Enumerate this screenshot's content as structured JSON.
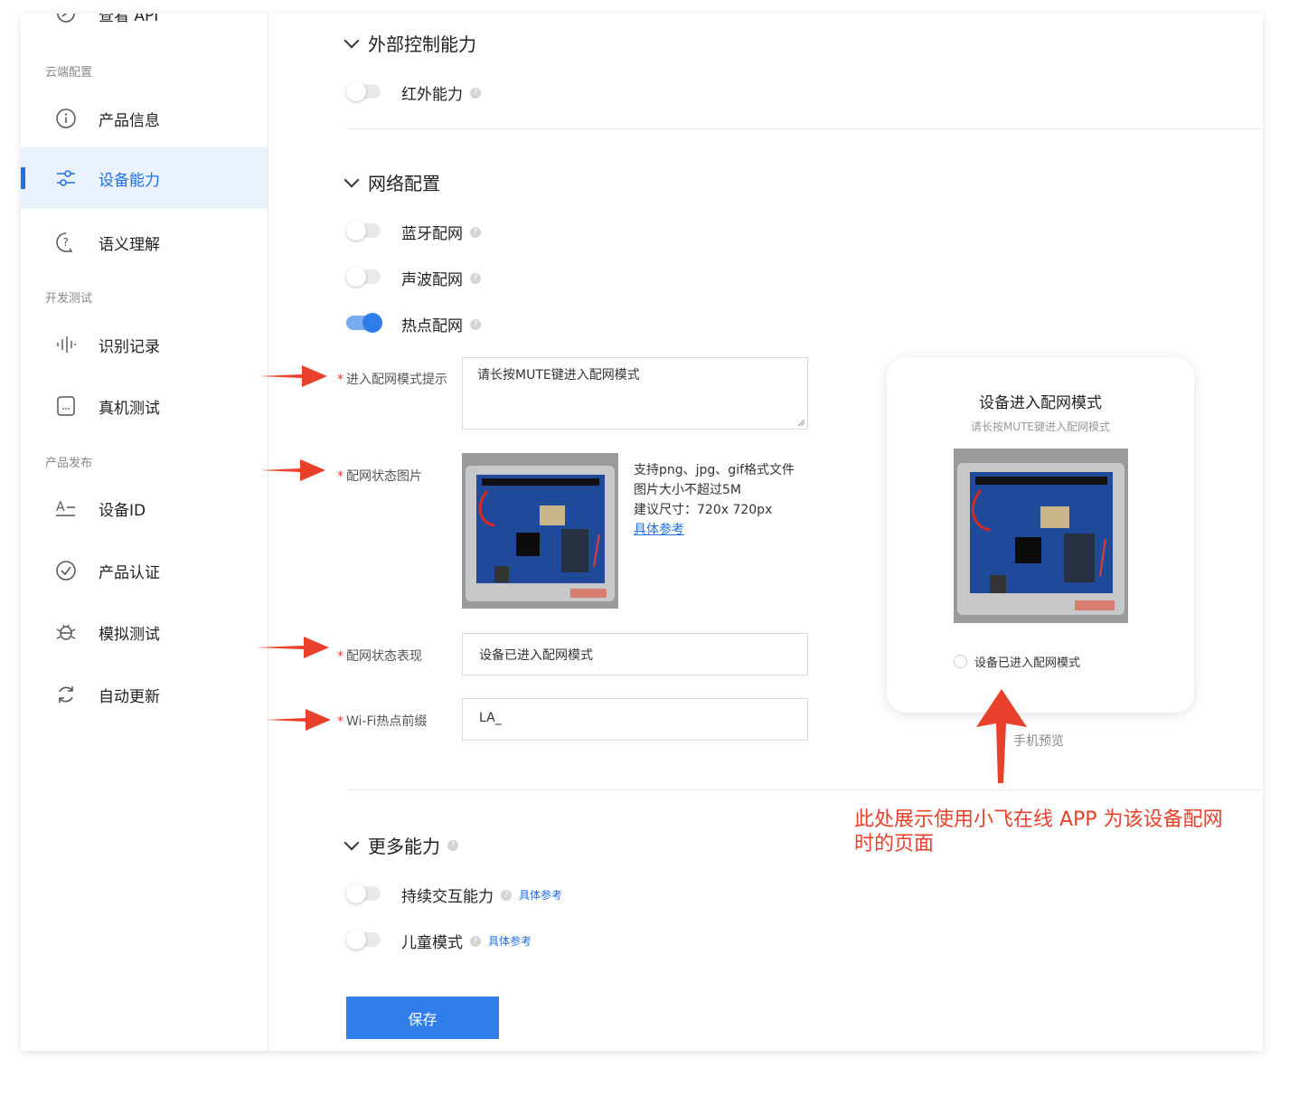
{
  "sidebar": {
    "top_cut_item": "查看 API",
    "sections": [
      {
        "label": "云端配置"
      },
      {
        "label": "开发测试"
      },
      {
        "label": "产品发布"
      }
    ],
    "items": [
      {
        "label": "产品信息",
        "icon": "info-icon"
      },
      {
        "label": "设备能力",
        "icon": "sliders-icon"
      },
      {
        "label": "语义理解",
        "icon": "question-bubble-icon"
      },
      {
        "label": "识别记录",
        "icon": "waveform-icon"
      },
      {
        "label": "真机测试",
        "icon": "device-chat-icon"
      },
      {
        "label": "设备ID",
        "icon": "id-text-icon"
      },
      {
        "label": "产品认证",
        "icon": "check-circle-icon"
      },
      {
        "label": "模拟测试",
        "icon": "bug-icon"
      },
      {
        "label": "自动更新",
        "icon": "refresh-icon"
      }
    ]
  },
  "main": {
    "external_control": {
      "title": "外部控制能力",
      "toggles": [
        {
          "label": "红外能力",
          "on": false
        }
      ]
    },
    "network_config": {
      "title": "网络配置",
      "toggles": [
        {
          "label": "蓝牙配网",
          "on": false
        },
        {
          "label": "声波配网",
          "on": false
        },
        {
          "label": "热点配网",
          "on": true
        }
      ],
      "fields": {
        "prompt_label": "进入配网模式提示",
        "prompt_value": "请长按MUTE键进入配网模式",
        "image_label": "配网状态图片",
        "image_hint": [
          "支持png、jpg、gif格式文件",
          "图片大小不超过5M",
          "建议尺寸：720x 720px"
        ],
        "image_hint_link": "具体参考",
        "status_label": "配网状态表现",
        "status_value": "设备已进入配网模式",
        "wifi_label": "Wi-Fi热点前缀",
        "wifi_value": "LA_"
      }
    },
    "more_abilities": {
      "title": "更多能力",
      "toggles": [
        {
          "label": "持续交互能力",
          "on": false,
          "link": "具体参考"
        },
        {
          "label": "儿童模式",
          "on": false,
          "link": "具体参考"
        }
      ]
    },
    "save_label": "保存"
  },
  "preview": {
    "title": "设备进入配网模式",
    "subtitle": "请长按MUTE键进入配网模式",
    "radio_label": "设备已进入配网模式",
    "caption": "手机预览"
  },
  "annotation": "此处展示使用小飞在线 APP 为该设备配网时的页面",
  "colors": {
    "accent": "#2f7de8",
    "annotation_red": "#e8402a",
    "active_bg": "#e9f2fd"
  }
}
